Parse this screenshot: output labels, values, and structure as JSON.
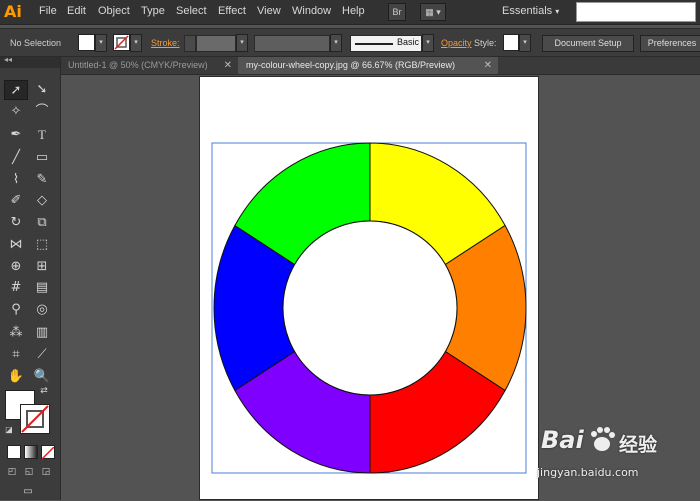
{
  "app": {
    "logo": "Ai"
  },
  "menubar": {
    "items": [
      "File",
      "Edit",
      "Object",
      "Type",
      "Select",
      "Effect",
      "View",
      "Window",
      "Help"
    ],
    "bridge_label": "Br",
    "workspace_label": "Essentials"
  },
  "controlbar": {
    "selection_status": "No Selection",
    "stroke_label": "Stroke:",
    "brush_label": "Basic",
    "opacity_label": "Opacity",
    "style_label": "Style:",
    "document_setup_button": "Document Setup",
    "preferences_button": "Preferences"
  },
  "tabs": [
    {
      "label": "Untitled-1 @ 50% (CMYK/Preview)",
      "active": false
    },
    {
      "label": "my-colour-wheel-copy.jpg @ 66.67% (RGB/Preview)",
      "active": true
    }
  ],
  "canvas": {
    "wheel_segment_colors": [
      "#ffff00",
      "#ff8000",
      "#ff0000",
      "#8000ff",
      "#0000ff",
      "#00ff00"
    ]
  },
  "watermark": {
    "logo_text": "Bai",
    "logo_suffix": "经验",
    "url": "jingyan.baidu.com"
  }
}
